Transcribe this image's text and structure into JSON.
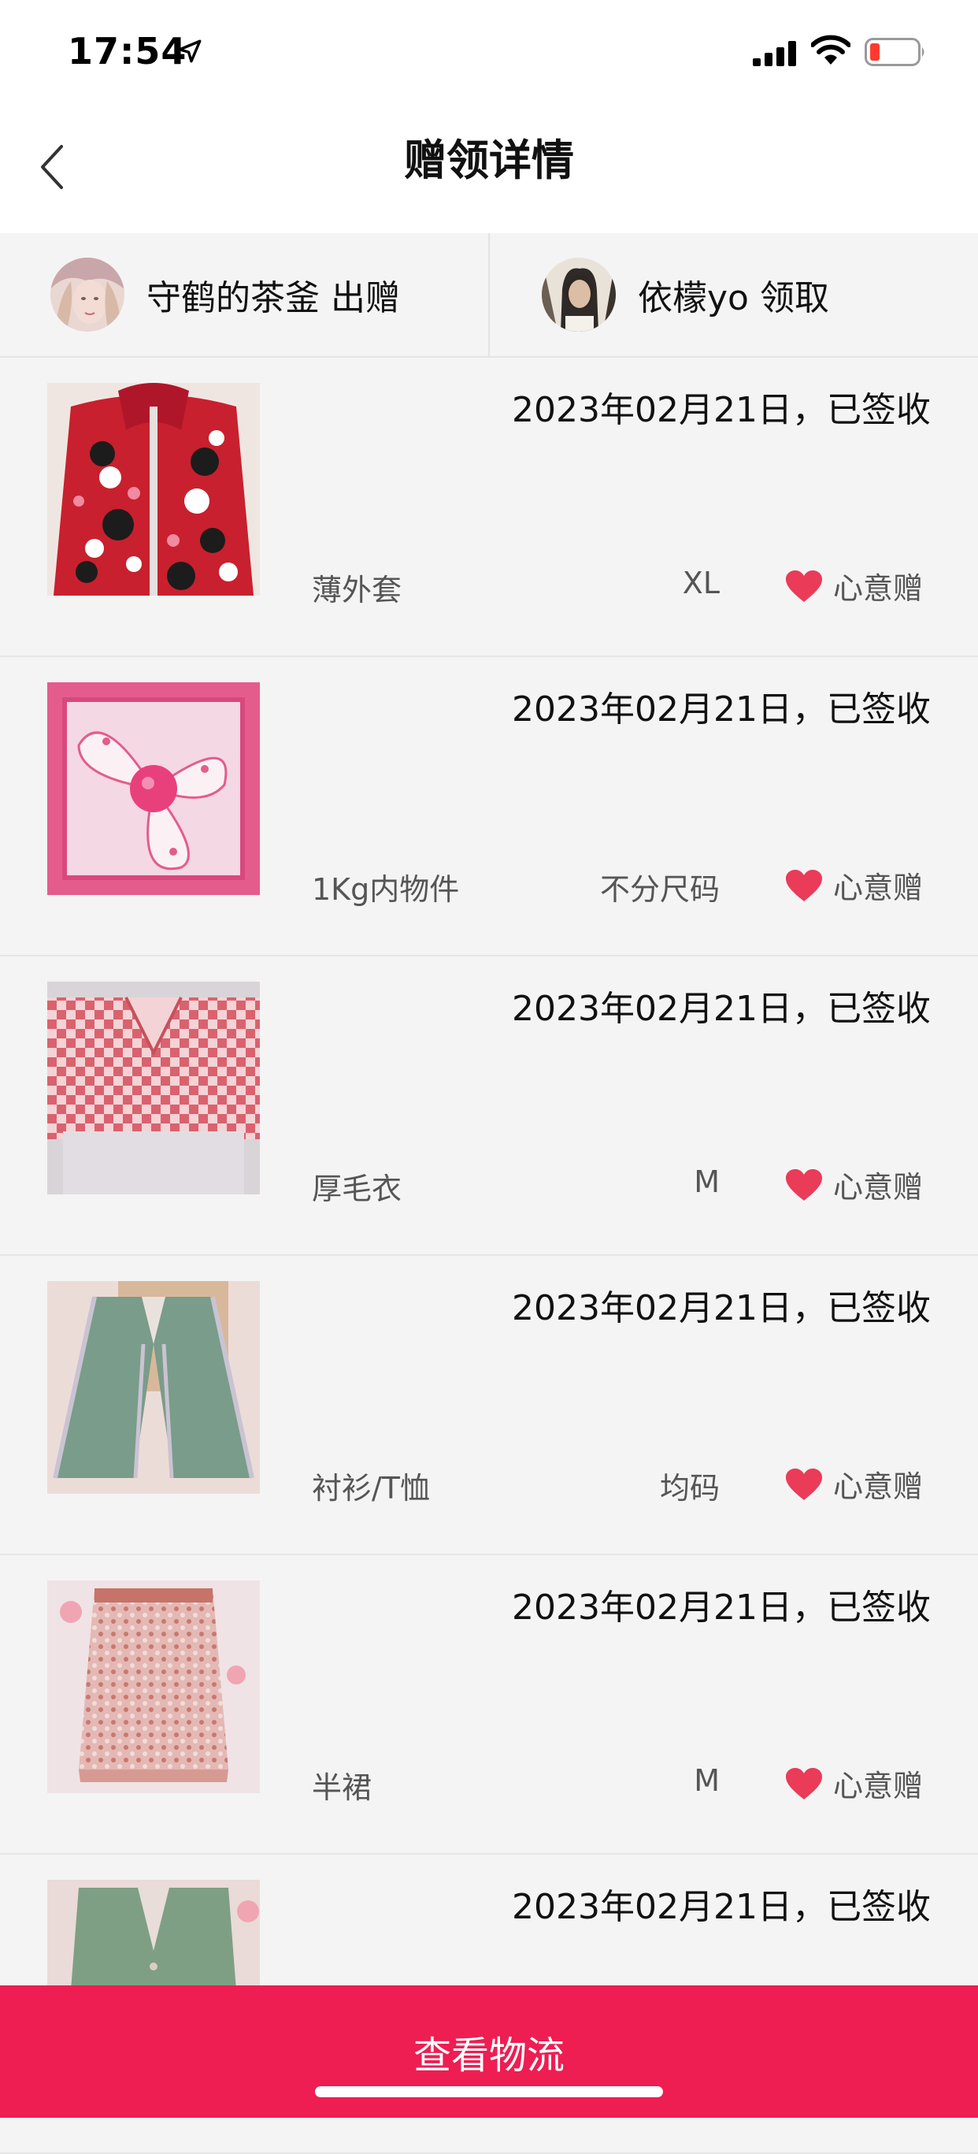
{
  "status_bar": {
    "time": "17:54",
    "icons": [
      "location-arrow-icon",
      "signal-icon",
      "wifi-icon",
      "battery-low-icon"
    ]
  },
  "header": {
    "title": "赠领详情"
  },
  "participants": {
    "giver": {
      "name": "守鹤的茶釜",
      "action": "出赠"
    },
    "receiver": {
      "name": "依檬yo",
      "action": "领取"
    }
  },
  "items": [
    {
      "date_status": "2023年02月21日，已签收",
      "category": "薄外套",
      "size": "XL",
      "tag": "心意赠"
    },
    {
      "date_status": "2023年02月21日，已签收",
      "category": "1Kg内物件",
      "size": "不分尺码",
      "tag": "心意赠"
    },
    {
      "date_status": "2023年02月21日，已签收",
      "category": "厚毛衣",
      "size": "M",
      "tag": "心意赠"
    },
    {
      "date_status": "2023年02月21日，已签收",
      "category": "衬衫/T恤",
      "size": "均码",
      "tag": "心意赠"
    },
    {
      "date_status": "2023年02月21日，已签收",
      "category": "半裙",
      "size": "M",
      "tag": "心意赠"
    },
    {
      "date_status": "2023年02月21日，已签收"
    }
  ],
  "bottom": {
    "button_label": "查看物流"
  },
  "colors": {
    "accent": "#ee1d52",
    "heart": "#ea3b58",
    "background": "#f4f4f4"
  }
}
